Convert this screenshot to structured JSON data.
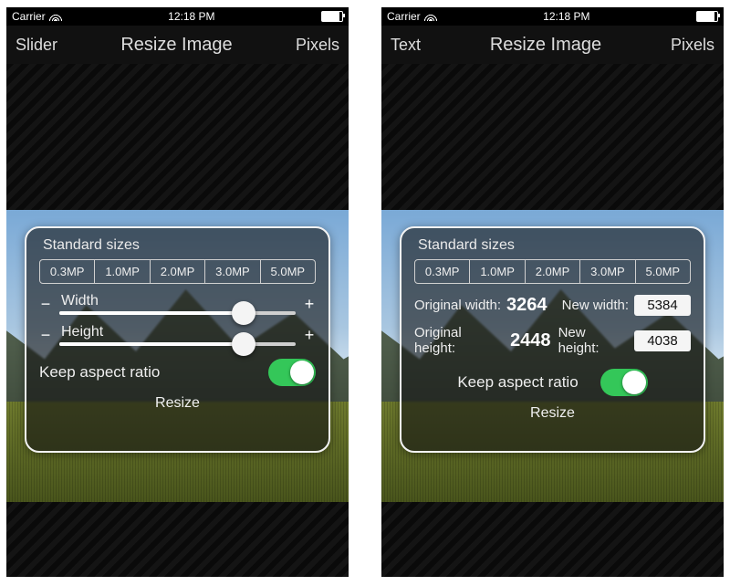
{
  "status": {
    "carrier": "Carrier",
    "time": "12:18 PM"
  },
  "nav": {
    "left_left": "Slider",
    "left_right": "Text",
    "title": "Resize Image",
    "right": "Pixels"
  },
  "panel": {
    "heading": "Standard sizes",
    "sizes": [
      "0.3MP",
      "1.0MP",
      "2.0MP",
      "3.0MP",
      "5.0MP"
    ],
    "width_label": "Width",
    "height_label": "Height",
    "aspect_label": "Keep aspect ratio",
    "resize_label": "Resize",
    "slider": {
      "width_pct": 78,
      "height_pct": 78
    },
    "text": {
      "orig_width_label": "Original width:",
      "orig_width_value": "3264",
      "new_width_label": "New width:",
      "new_width_value": "5384",
      "orig_height_label": "Original height:",
      "orig_height_value": "2448",
      "new_height_label": "New height:",
      "new_height_value": "4038"
    }
  }
}
